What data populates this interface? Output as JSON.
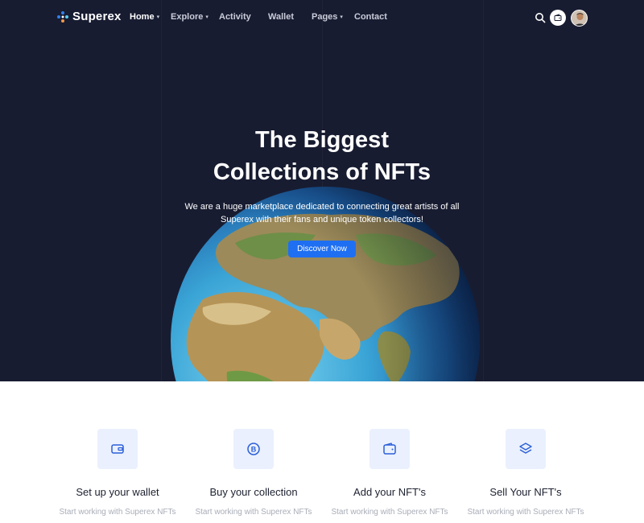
{
  "brand": {
    "name": "Superex"
  },
  "nav": {
    "items": [
      {
        "label": "Home",
        "active": true,
        "has_dropdown": true
      },
      {
        "label": "Explore",
        "active": false,
        "has_dropdown": true
      },
      {
        "label": "Activity",
        "active": false,
        "has_dropdown": false
      },
      {
        "label": "Wallet",
        "active": false,
        "has_dropdown": false
      },
      {
        "label": "Pages",
        "active": false,
        "has_dropdown": true
      },
      {
        "label": "Contact",
        "active": false,
        "has_dropdown": false
      }
    ],
    "icons": [
      "search-icon",
      "wallet-icon",
      "avatar"
    ]
  },
  "hero": {
    "title_line1": "The Biggest",
    "title_line2": "Collections of NFTs",
    "subtitle_line1": "We are a huge marketplace dedicated to connecting great artists of all",
    "subtitle_line2": "Superex with their fans and unique token collectors!",
    "cta_label": "Discover Now"
  },
  "features": [
    {
      "title": "Set up your wallet",
      "text": "Start working with Superex NFTs",
      "icon": "wallet-icon"
    },
    {
      "title": "Buy your collection",
      "text": "Start working with Superex NFTs",
      "icon": "coin-icon"
    },
    {
      "title": "Add your NFT's",
      "text": "Start working with Superex NFTs",
      "icon": "wallet-add-icon"
    },
    {
      "title": "Sell Your NFT's",
      "text": "Start working with Superex NFTs",
      "icon": "layers-icon"
    }
  ],
  "colors": {
    "hero_bg": "#181c31",
    "accent": "#1f6ff2",
    "icon_tile": "#eaf0fd"
  }
}
